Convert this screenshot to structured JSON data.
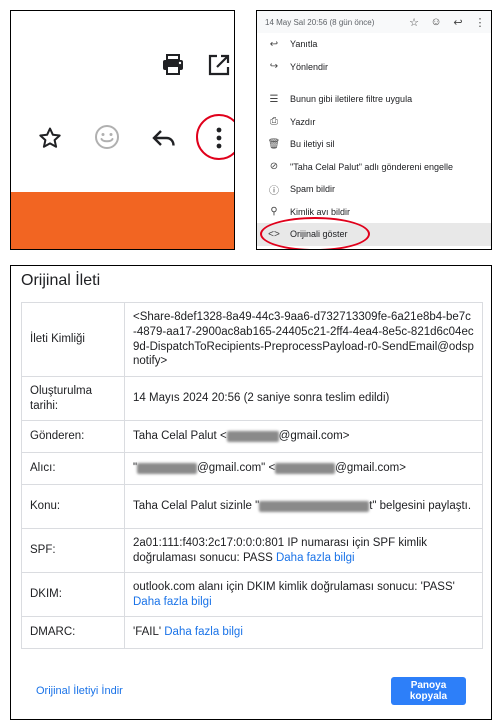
{
  "toolbar_zoom": {
    "icons": [
      "print-icon",
      "open-in-new-icon",
      "star-icon",
      "emoji-icon",
      "reply-icon",
      "more-vert-icon"
    ],
    "accent": "#f26522"
  },
  "menu": {
    "date": "14 May Sal 20:56 (8 gün önce)",
    "items": [
      {
        "icon": "reply-icon",
        "label": "Yanıtla"
      },
      {
        "icon": "forward-icon",
        "label": "Yönlendir"
      },
      {
        "icon": "filter-icon",
        "label": "Bunun gibi iletilere filtre uygula"
      },
      {
        "icon": "print-icon",
        "label": "Yazdır"
      },
      {
        "icon": "delete-icon",
        "label": "Bu iletiyi sil"
      },
      {
        "icon": "block-icon",
        "label": "\"Taha Celal Palut\" adlı göndereni engelle"
      },
      {
        "icon": "spam-icon",
        "label": "Spam bildir"
      },
      {
        "icon": "phishing-icon",
        "label": "Kimlik avı bildir"
      },
      {
        "icon": "code-icon",
        "label": "Orijinali göster"
      }
    ]
  },
  "original": {
    "title": "Orijinal İleti",
    "rows": {
      "message_id_label": "İleti Kimliği",
      "message_id_value": "<Share-8def1328-8a49-44c3-9aa6-d732713309fe-6a21e8b4-be7c-4879-aa17-2900ac8ab165-24405c21-2ff4-4ea4-8e5c-821d6c04ec9d-DispatchToRecipients-PreprocessPayload-r0-SendEmail@odspnotify>",
      "created_label": "Oluşturulma tarihi:",
      "created_value": "14 Mayıs 2024 20:56 (2 saniye sonra teslim edildi)",
      "from_label": "Gönderen:",
      "from_value_prefix": "Taha Celal Palut <",
      "from_value_suffix": "@gmail.com>",
      "to_label": "Alıcı:",
      "to_value_a": "\"",
      "to_value_b": "@gmail.com\" <",
      "to_value_c": "@gmail.com>",
      "subject_label": "Konu:",
      "subject_value_a": "Taha Celal Palut sizinle \"",
      "subject_value_b": "t\" belgesini paylaştı.",
      "spf_label": "SPF:",
      "spf_value": "2a01:111:f403:2c17:0:0:0:801 IP numarası için SPF kimlik doğrulaması sonucu: PASS ",
      "dkim_label": "DKIM:",
      "dkim_value": "outlook.com alanı için DKIM kimlik doğrulaması sonucu: 'PASS' ",
      "dmarc_label": "DMARC:",
      "dmarc_value": "'FAIL' ",
      "more_info": "Daha fazla bilgi"
    },
    "download_link": "Orijinal İletiyi İndir",
    "copy_button": "Panoya kopyala"
  }
}
